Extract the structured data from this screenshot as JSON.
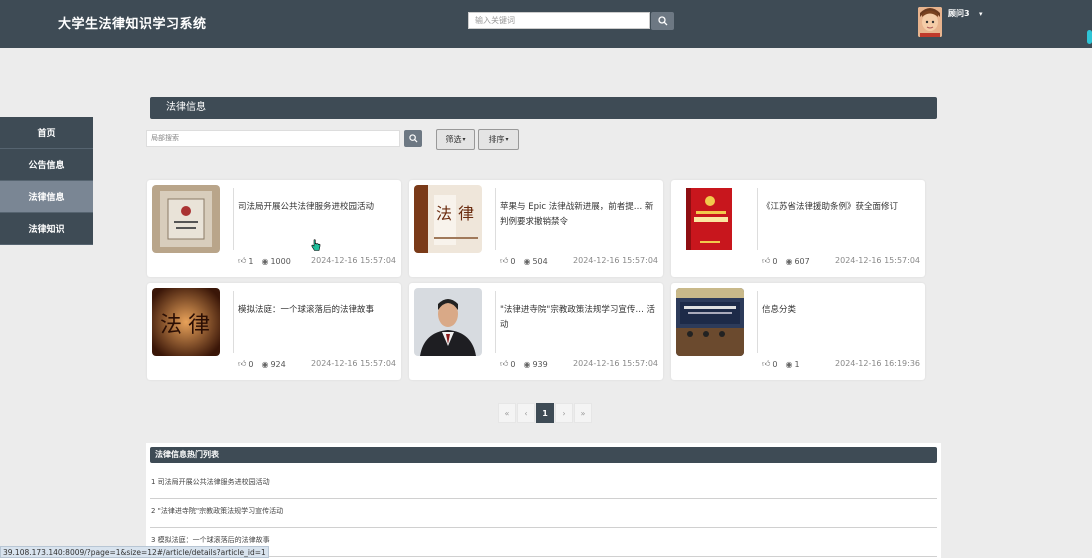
{
  "header": {
    "app_title": "大学生法律知识学习系统",
    "search_placeholder": "输入关键词",
    "username": "顾问3",
    "caret": "▾"
  },
  "sidebar": {
    "items": [
      {
        "label": "首页",
        "active": false
      },
      {
        "label": "公告信息",
        "active": false
      },
      {
        "label": "法律信息",
        "active": true
      },
      {
        "label": "法律知识",
        "active": false
      }
    ]
  },
  "main": {
    "section_title": "法律信息",
    "local_search_placeholder": "局部搜索",
    "filter_label": "筛选",
    "sort_label": "排序",
    "cards": [
      {
        "title": "司法局开展公共法律服务进校园活动",
        "likes": "1",
        "views": "1000",
        "date": "2024-12-16 15:57:04",
        "image": "plaque-photo"
      },
      {
        "title": "苹果与 Epic 法律战新进展，前者提… 新判例要求撤销禁令",
        "likes": "0",
        "views": "504",
        "date": "2024-12-16 15:57:04",
        "image": "law-characters-photo"
      },
      {
        "title": "《江苏省法律援助条例》获全面修订",
        "likes": "0",
        "views": "607",
        "date": "2024-12-16 15:57:04",
        "image": "red-law-book"
      },
      {
        "title": "模拟法庭：一个球滚落后的法律故事",
        "likes": "0",
        "views": "924",
        "date": "2024-12-16 15:57:04",
        "image": "law-characters-dark"
      },
      {
        "title": "\"法律进寺院\"宗教政策法规学习宣传… 活动",
        "likes": "0",
        "views": "939",
        "date": "2024-12-16 15:57:04",
        "image": "lawyer-portrait"
      },
      {
        "title": "信息分类",
        "likes": "0",
        "views": "1",
        "date": "2024-12-16 16:19:36",
        "image": "courtroom-photo"
      }
    ],
    "pagination": {
      "first": "«",
      "prev": "‹",
      "current": "1",
      "next": "›",
      "last": "»"
    }
  },
  "hot_list": {
    "title": "法律信息热门列表",
    "items": [
      "1  司法局开展公共法律服务进校园活动",
      "2  \"法律进寺院\"宗教政策法规学习宣传活动",
      "3  模拟法庭：一个球滚落后的法律故事"
    ]
  },
  "status_url": "39.108.173.140:8009/?page=1&size=12#/article/details?article_id=1",
  "colors": {
    "primary": "#3e4b55",
    "active_side": "#7a8694",
    "background": "#ececec"
  }
}
